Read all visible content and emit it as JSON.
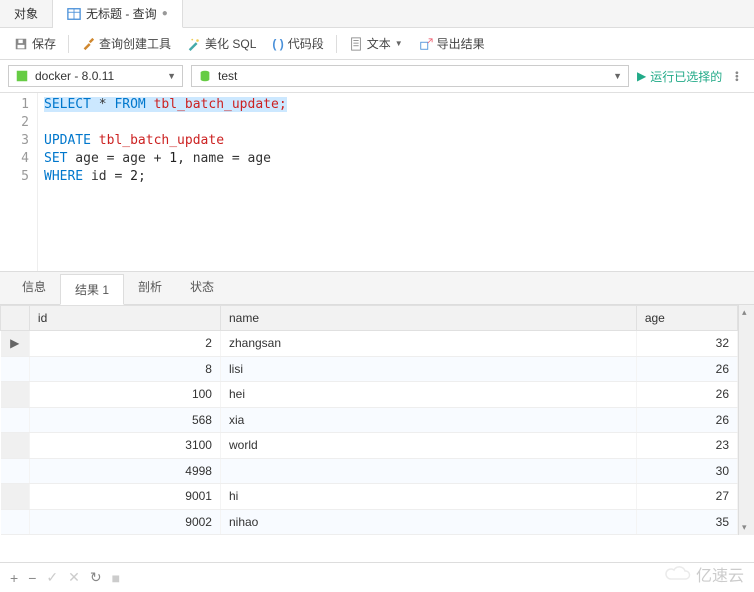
{
  "top_tabs": {
    "objects": "对象",
    "query": "无标题 - 查询"
  },
  "toolbar": {
    "save": "保存",
    "query_builder": "查询创建工具",
    "beautify": "美化 SQL",
    "snippet": "代码段",
    "text": "文本",
    "export": "导出结果"
  },
  "conn": {
    "server": "docker - 8.0.11",
    "database": "test",
    "run": "运行已选择的"
  },
  "code": {
    "l1a": "SELECT",
    "l1b": " * ",
    "l1c": "FROM",
    "l1d": " tbl_batch_update;",
    "l3a": "UPDATE",
    "l3b": " tbl_batch_update",
    "l4a": "SET",
    "l4b": " age = age + ",
    "l4c": "1",
    "l4d": ", name = age",
    "l5a": "WHERE",
    "l5b": " id = ",
    "l5c": "2",
    "l5d": ";"
  },
  "result_tabs": {
    "info": "信息",
    "result1": "结果 1",
    "profile": "剖析",
    "status": "状态"
  },
  "grid": {
    "headers": {
      "id": "id",
      "name": "name",
      "age": "age"
    },
    "rows": [
      {
        "id": "2",
        "name": "zhangsan",
        "age": "32"
      },
      {
        "id": "8",
        "name": "lisi",
        "age": "26"
      },
      {
        "id": "100",
        "name": "hei",
        "age": "26"
      },
      {
        "id": "568",
        "name": "xia",
        "age": "26"
      },
      {
        "id": "3100",
        "name": "world",
        "age": "23"
      },
      {
        "id": "4998",
        "name": "",
        "age": "30"
      },
      {
        "id": "9001",
        "name": "hi",
        "age": "27"
      },
      {
        "id": "9002",
        "name": "nihao",
        "age": "35"
      }
    ]
  },
  "watermark": "亿速云",
  "chart_data": {
    "type": "table",
    "title": "tbl_batch_update",
    "columns": [
      "id",
      "name",
      "age"
    ],
    "rows": [
      [
        2,
        "zhangsan",
        32
      ],
      [
        8,
        "lisi",
        26
      ],
      [
        100,
        "hei",
        26
      ],
      [
        568,
        "xia",
        26
      ],
      [
        3100,
        "world",
        23
      ],
      [
        4998,
        null,
        30
      ],
      [
        9001,
        "hi",
        27
      ],
      [
        9002,
        "nihao",
        35
      ]
    ]
  }
}
